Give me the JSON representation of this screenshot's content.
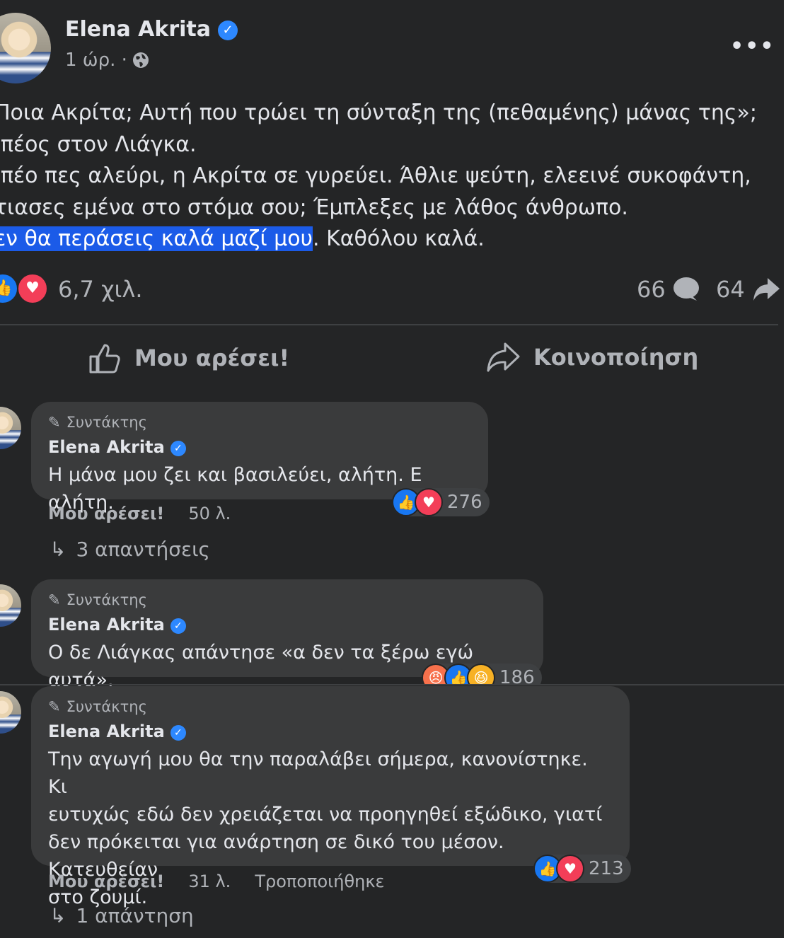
{
  "post": {
    "author": "Elena Akrita",
    "time": "1 ώρ. ·",
    "lines": [
      "Ποια Ακρίτα; Αυτή που τρώει τη σύνταξη της (πεθαμένης) μάνας της»;",
      "Ιπέος στον Λιάγκα.",
      "Ιπέο πες αλεύρι, η Ακρίτα σε γυρεύει. Άθλιε ψεύτη, ελεεινέ συκοφάντη,",
      "τιασες εμένα στο στόμα σου; Έμπλεξες με λάθος άνθρωπο."
    ],
    "last_line_highlighted": "εν θα περάσεις καλά μαζί μου",
    "last_line_rest": ". Καθόλου καλά.",
    "reactions_count": "6,7 χιλ.",
    "comments_count": "66",
    "shares_count": "64",
    "like_action": "Μου αρέσει!",
    "share_action": "Κοινοποίηση"
  },
  "comments": [
    {
      "role": "Συντάκτης",
      "author": "Elena Akrita",
      "text": "Η μάνα μου ζει και βασιλεύει, αλήτη. Ε αλήτη.",
      "reactions": "276",
      "like": "Μου αρέσει!",
      "time": "50 λ.",
      "replies": "3 απαντήσεις"
    },
    {
      "role": "Συντάκτης",
      "author": "Elena Akrita",
      "text": "Ο δε Λιάγκας απάντησε «α δεν τα ξέρω εγώ αυτά».",
      "reactions": "186"
    },
    {
      "role": "Συντάκτης",
      "author": "Elena Akrita",
      "text_lines": [
        "Την αγωγή μου θα την παραλάβει σήμερα, κανονίστηκε. Κι",
        "ευτυχώς εδώ δεν χρειάζεται να προηγηθεί εξώδικο, γιατί",
        "δεν πρόκειται για ανάρτηση σε δικό του μέσον. Κατευθείαν",
        "στο ζουμί."
      ],
      "reactions": "213",
      "like": "Μου αρέσει!",
      "time": "31 λ.",
      "edited": "Τροποποιήθηκε",
      "replies": "1 απάντηση"
    }
  ],
  "icons": {
    "verified": "verified-badge-icon",
    "globe": "globe-icon",
    "more": "more-options-icon",
    "like": "thumbs-up-icon",
    "love": "heart-icon",
    "angry": "angry-face-icon",
    "haha": "haha-face-icon",
    "share": "share-arrow-icon",
    "comment": "comment-bubble-icon",
    "pencil": "pencil-icon",
    "reply": "reply-arrow-icon"
  },
  "colors": {
    "background": "#242526",
    "bubble": "#3a3b3c",
    "text": "#e4e6eb",
    "secondary_text": "#b0b3b8",
    "link_blue": "#2d88ff",
    "like_blue": "#1877f2",
    "love_red": "#f33e58",
    "highlight": "#1b5be8"
  }
}
